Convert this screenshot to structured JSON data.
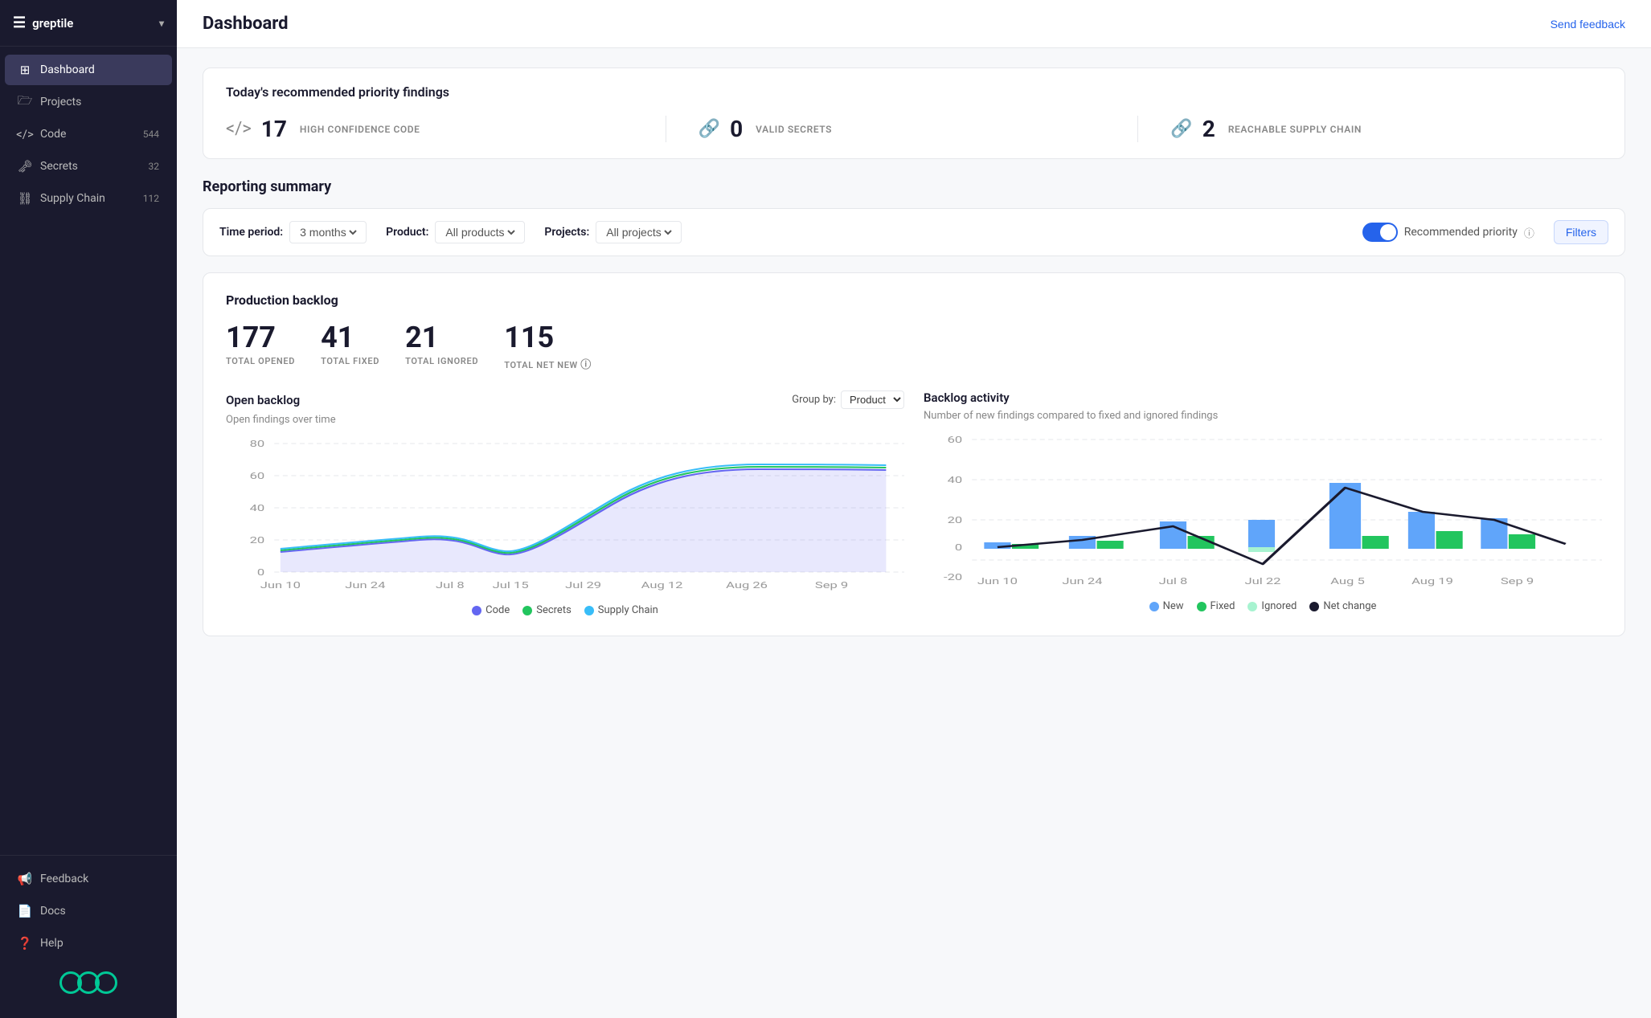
{
  "sidebar": {
    "app_name": "greptile",
    "items": [
      {
        "id": "dashboard",
        "label": "Dashboard",
        "icon": "grid",
        "badge": null,
        "active": true
      },
      {
        "id": "projects",
        "label": "Projects",
        "icon": "folder",
        "badge": null,
        "active": false
      },
      {
        "id": "code",
        "label": "Code",
        "icon": "code",
        "badge": "544",
        "active": false
      },
      {
        "id": "secrets",
        "label": "Secrets",
        "icon": "key",
        "badge": "32",
        "active": false
      },
      {
        "id": "supply-chain",
        "label": "Supply Chain",
        "icon": "link",
        "badge": "112",
        "active": false
      }
    ],
    "bottom_items": [
      {
        "id": "feedback",
        "label": "Feedback",
        "icon": "megaphone"
      },
      {
        "id": "docs",
        "label": "Docs",
        "icon": "doc"
      },
      {
        "id": "help",
        "label": "Help",
        "icon": "question"
      }
    ]
  },
  "header": {
    "title": "Dashboard",
    "send_feedback_label": "Send feedback"
  },
  "priority_section": {
    "title": "Today's recommended priority findings",
    "metrics": [
      {
        "number": "17",
        "label": "HIGH CONFIDENCE CODE"
      },
      {
        "number": "0",
        "label": "VALID SECRETS"
      },
      {
        "number": "2",
        "label": "REACHABLE SUPPLY CHAIN"
      }
    ]
  },
  "reporting": {
    "title": "Reporting summary",
    "filters": {
      "time_period_label": "Time period:",
      "time_period_value": "3 months",
      "product_label": "Product:",
      "product_value": "All products",
      "projects_label": "Projects:",
      "projects_value": "All projects",
      "toggle_label": "Recommended priority",
      "filters_btn": "Filters"
    }
  },
  "backlog": {
    "title": "Production backlog",
    "stats": [
      {
        "number": "177",
        "label": "TOTAL OPENED"
      },
      {
        "number": "41",
        "label": "TOTAL FIXED"
      },
      {
        "number": "21",
        "label": "TOTAL IGNORED"
      },
      {
        "number": "115",
        "label": "TOTAL NET NEW"
      }
    ],
    "open_backlog": {
      "title": "Open backlog",
      "subtitle": "Open findings over time",
      "group_by_label": "Group by:",
      "group_by_value": "Product",
      "x_labels": [
        "Jun 10",
        "Jun 24",
        "Jul 8",
        "Jul 15",
        "Jul 29",
        "Aug 12",
        "Aug 26",
        "Sep 9"
      ],
      "y_labels": [
        "0",
        "20",
        "40",
        "60",
        "80"
      ],
      "legend": [
        {
          "label": "Code",
          "color": "#6366f1"
        },
        {
          "label": "Secrets",
          "color": "#22c55e"
        },
        {
          "label": "Supply Chain",
          "color": "#38bdf8"
        }
      ]
    },
    "backlog_activity": {
      "title": "Backlog activity",
      "subtitle": "Number of new findings compared to fixed and ignored findings",
      "x_labels": [
        "Jun 10",
        "Jun 24",
        "Jul 8",
        "Jul 22",
        "Aug 5",
        "Aug 19",
        "Sep 9"
      ],
      "y_labels": [
        "-20",
        "0",
        "20",
        "40",
        "60"
      ],
      "legend": [
        {
          "label": "New",
          "color": "#60a5fa"
        },
        {
          "label": "Fixed",
          "color": "#22c55e"
        },
        {
          "label": "Ignored",
          "color": "#a7f3d0"
        },
        {
          "label": "Net change",
          "color": "#1a1a2e"
        }
      ]
    }
  }
}
